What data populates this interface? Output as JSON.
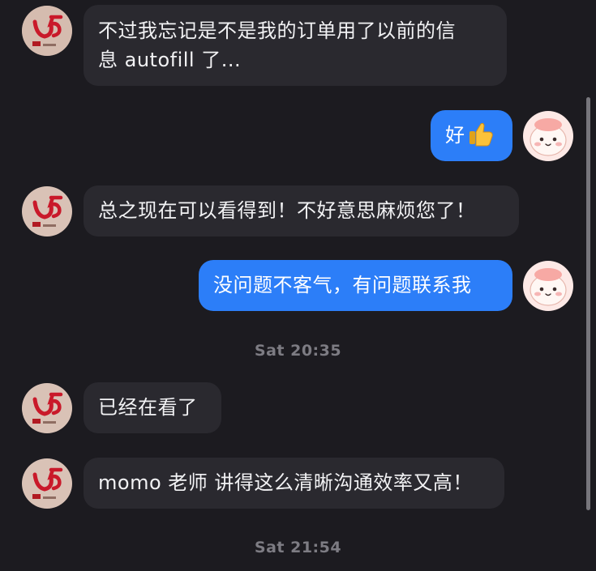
{
  "messages": [
    {
      "side": "in",
      "lines": [
        "不过我忘记是不是我的订单用了以前的信",
        "息 autofill 了..."
      ]
    },
    {
      "side": "out",
      "text": "好",
      "emoji": "thumbs-up"
    },
    {
      "side": "in",
      "text": "总之现在可以看得到！不好意思麻烦您了！"
    },
    {
      "side": "out",
      "text": "没问题不客气，有问题联系我"
    },
    {
      "side": "in",
      "text": "已经在看了"
    },
    {
      "side": "in",
      "text": "momo 老师 讲得这么清晰沟通效率又高！"
    }
  ],
  "timestamps": [
    "Sat 20:35",
    "Sat 21:54"
  ],
  "colors": {
    "background": "#1c1b20",
    "incoming_bubble": "#2a292f",
    "outgoing_bubble": "#2c7ef8",
    "timestamp_text": "#7d7c83"
  }
}
